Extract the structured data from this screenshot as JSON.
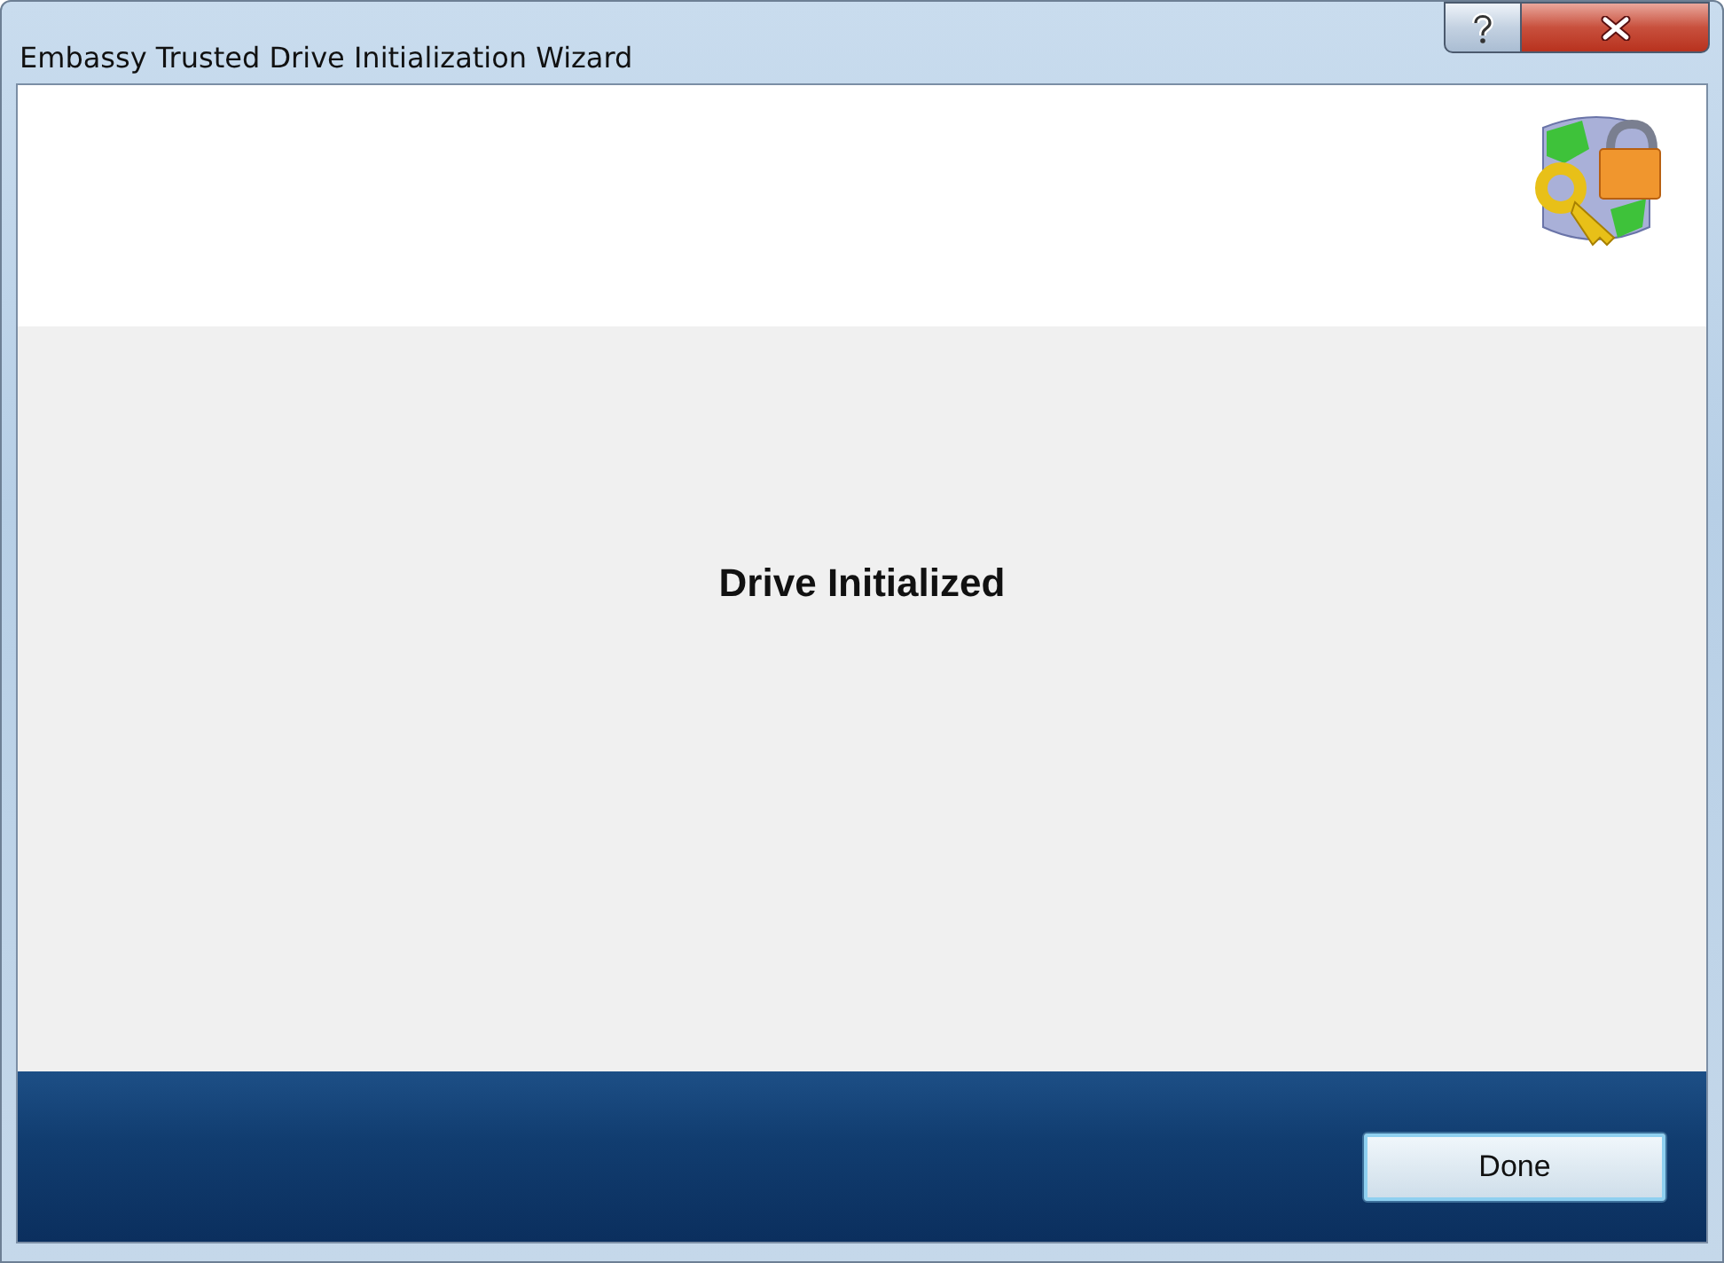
{
  "window": {
    "title": "Embassy Trusted Drive Initialization Wizard"
  },
  "message": "Drive Initialized",
  "buttons": [
    {
      "label": "Done"
    }
  ]
}
